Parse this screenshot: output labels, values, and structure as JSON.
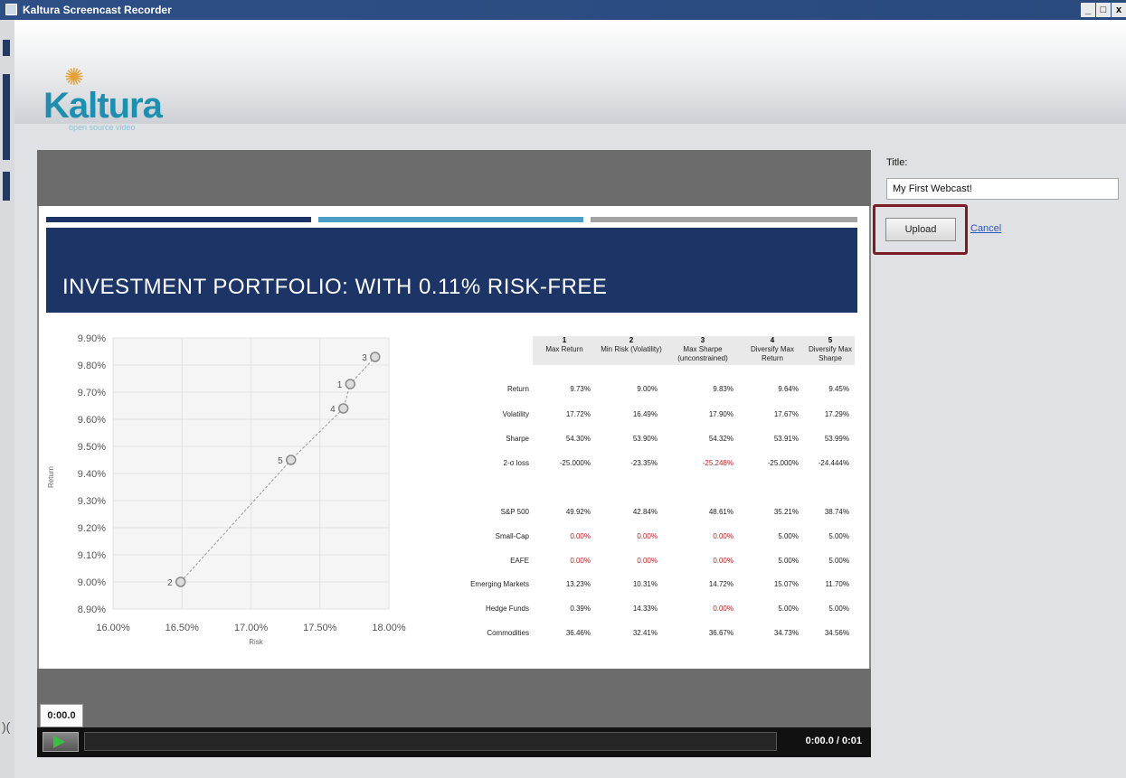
{
  "window": {
    "title": "Kaltura Screencast Recorder",
    "controls": [
      "_",
      "□",
      "x"
    ]
  },
  "logo": {
    "name": "Kaltura",
    "tagline": "open source video"
  },
  "slide": {
    "title": "INVESTMENT PORTFOLIO: WITH 0.11% RISK-FREE"
  },
  "chart_data": {
    "type": "scatter",
    "xlabel": "Risk",
    "ylabel": "Return",
    "xlim": [
      0.16,
      0.18
    ],
    "ylim": [
      0.089,
      0.099
    ],
    "xticks": [
      "16.00%",
      "16.50%",
      "17.00%",
      "17.50%",
      "18.00%"
    ],
    "yticks": [
      "8.90%",
      "9.00%",
      "9.10%",
      "9.20%",
      "9.30%",
      "9.40%",
      "9.50%",
      "9.60%",
      "9.70%",
      "9.80%",
      "9.90%"
    ],
    "points": [
      {
        "label": "1",
        "x": 0.1772,
        "y": 0.0973
      },
      {
        "label": "2",
        "x": 0.1649,
        "y": 0.09
      },
      {
        "label": "3",
        "x": 0.179,
        "y": 0.0983
      },
      {
        "label": "4",
        "x": 0.1767,
        "y": 0.0964
      },
      {
        "label": "5",
        "x": 0.1729,
        "y": 0.0945
      }
    ],
    "frontier": true,
    "grid": true
  },
  "table": {
    "columns": [
      {
        "num": "1",
        "label": "Max Return"
      },
      {
        "num": "2",
        "label": "Min Risk (Volatility)"
      },
      {
        "num": "3",
        "label": "Max Sharpe (unconstrained)"
      },
      {
        "num": "4",
        "label": "Diversify Max Return"
      },
      {
        "num": "5",
        "label": "Diversify Max Sharpe"
      }
    ],
    "rows": [
      {
        "label": "Return",
        "values": [
          "9.73%",
          "9.00%",
          "9.83%",
          "9.64%",
          "9.45%"
        ]
      },
      {
        "label": "Volatility",
        "values": [
          "17.72%",
          "16.49%",
          "17.90%",
          "17.67%",
          "17.29%"
        ]
      },
      {
        "label": "Sharpe",
        "values": [
          "54.30%",
          "53.90%",
          "54.32%",
          "53.91%",
          "53.99%"
        ]
      },
      {
        "label": "2-σ loss",
        "values": [
          "-25.000%",
          "-23.35%",
          "-25.248%",
          "-25.000%",
          "-24.444%"
        ]
      },
      {
        "label": "S&P 500",
        "values": [
          "49.92%",
          "42.84%",
          "48.61%",
          "35.21%",
          "38.74%"
        ]
      },
      {
        "label": "Small-Cap",
        "values": [
          "0.00%",
          "0.00%",
          "0.00%",
          "5.00%",
          "5.00%"
        ]
      },
      {
        "label": "EAFE",
        "values": [
          "0.00%",
          "0.00%",
          "0.00%",
          "5.00%",
          "5.00%"
        ]
      },
      {
        "label": "Emerging Markets",
        "values": [
          "13.23%",
          "10.31%",
          "14.72%",
          "15.07%",
          "11.70%"
        ]
      },
      {
        "label": "Hedge Funds",
        "values": [
          "0.39%",
          "14.33%",
          "0.00%",
          "5.00%",
          "5.00%"
        ]
      },
      {
        "label": "Commodities",
        "values": [
          "36.46%",
          "32.41%",
          "36.67%",
          "34.73%",
          "34.56%"
        ]
      }
    ]
  },
  "player": {
    "time_badge": "0:00.0",
    "time_readout": "0:00.0 / 0:01"
  },
  "side": {
    "title_label": "Title:",
    "title_value": "My First Webcast!",
    "upload_label": "Upload",
    "cancel_label": "Cancel"
  },
  "colors": {
    "banner": "#1d3466",
    "highlight": "#7a1c25",
    "link": "#2a56b8",
    "negative": "#b12525"
  }
}
